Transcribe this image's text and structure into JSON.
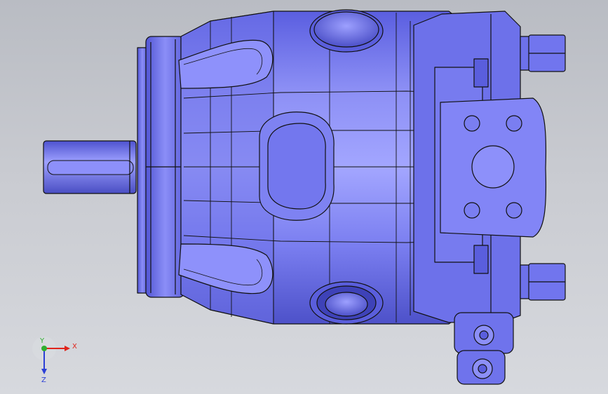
{
  "viewport": {
    "background_top": "#b9bcc3",
    "background_bottom": "#d7d9de"
  },
  "model": {
    "body_color": "#6b6fe8",
    "highlight_color": "#b8baff",
    "shadow_color": "#3f42b5",
    "edge_color": "#111111"
  },
  "triad": {
    "x_label": "X",
    "y_label": "Y",
    "z_label": "Z",
    "x_color": "#e0241b",
    "y_color": "#2fae2f",
    "z_color": "#2b3fd6"
  }
}
